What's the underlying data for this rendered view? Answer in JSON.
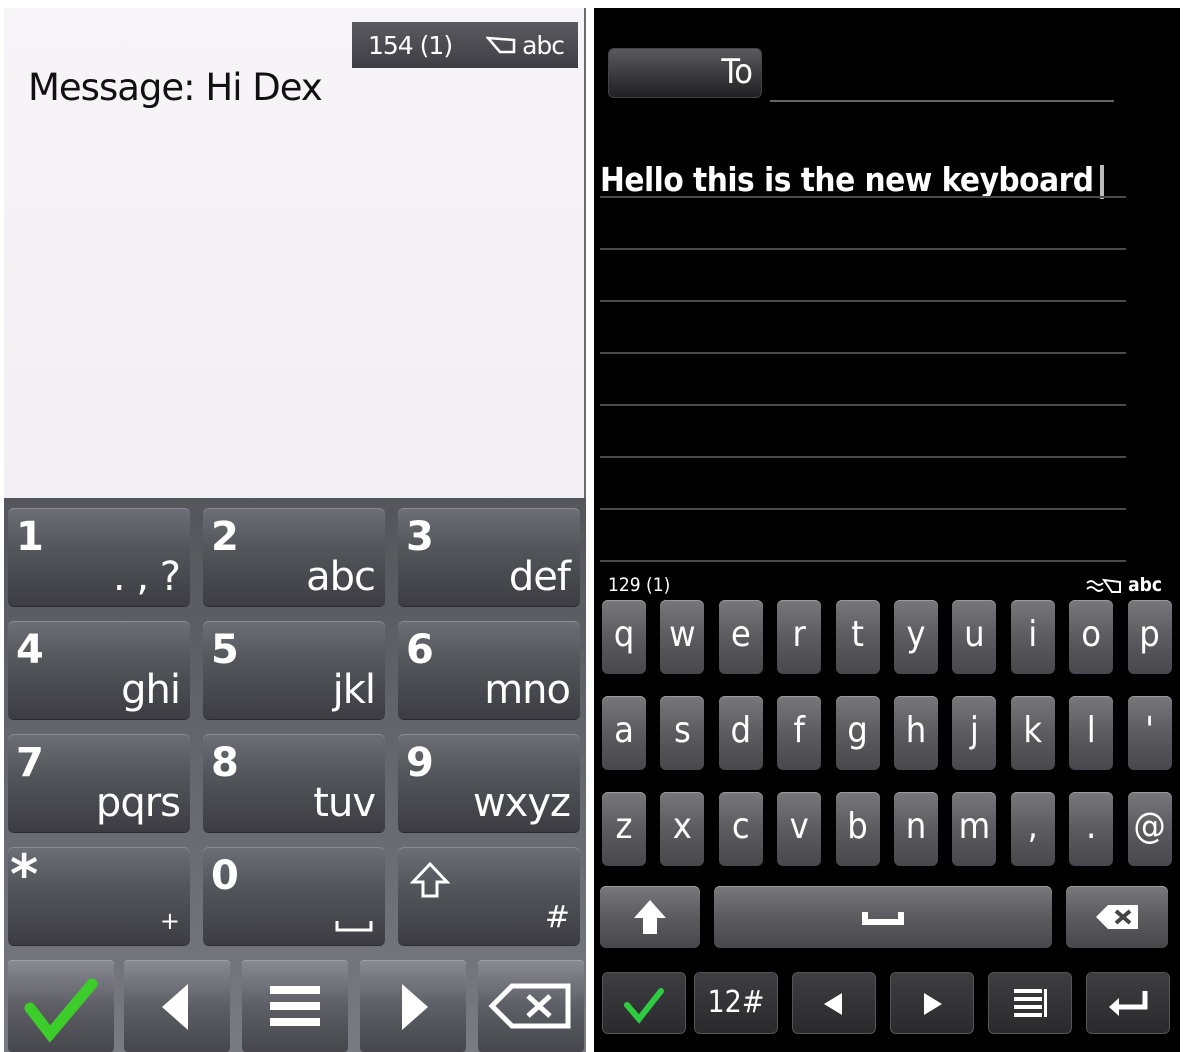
{
  "left_phone": {
    "status": {
      "char_count": "154 (1)",
      "input_mode": "abc"
    },
    "message_text": "Message: Hi Dex",
    "keypad": [
      {
        "num": "1",
        "letters": ". , ?"
      },
      {
        "num": "2",
        "letters": "abc"
      },
      {
        "num": "3",
        "letters": "def"
      },
      {
        "num": "4",
        "letters": "ghi"
      },
      {
        "num": "5",
        "letters": "jkl"
      },
      {
        "num": "6",
        "letters": "mno"
      },
      {
        "num": "7",
        "letters": "pqrs"
      },
      {
        "num": "8",
        "letters": "tuv"
      },
      {
        "num": "9",
        "letters": "wxyz"
      }
    ],
    "star_key": {
      "symbol": "*",
      "sub": "+"
    },
    "zero_key": {
      "num": "0"
    },
    "shift_key": {
      "sub": "#"
    },
    "bottom_bar": [
      "check-icon",
      "left-arrow-icon",
      "menu-icon",
      "right-arrow-icon",
      "backspace-icon"
    ]
  },
  "right_phone": {
    "to_label": "To",
    "body_text": "Hello this is the new keyboard",
    "char_count": "129 (1)",
    "input_mode": "abc",
    "rows": [
      [
        "q",
        "w",
        "e",
        "r",
        "t",
        "y",
        "u",
        "i",
        "o",
        "p"
      ],
      [
        "a",
        "s",
        "d",
        "f",
        "g",
        "h",
        "j",
        "k",
        "l",
        "'"
      ],
      [
        "z",
        "x",
        "c",
        "v",
        "b",
        "n",
        "m",
        ",",
        ".",
        "@"
      ]
    ],
    "numeric_label": "12#",
    "colors": {
      "accept_green": "#2ecc40",
      "key_grey": "#5c5c60",
      "screen_bg": "#000000"
    }
  }
}
